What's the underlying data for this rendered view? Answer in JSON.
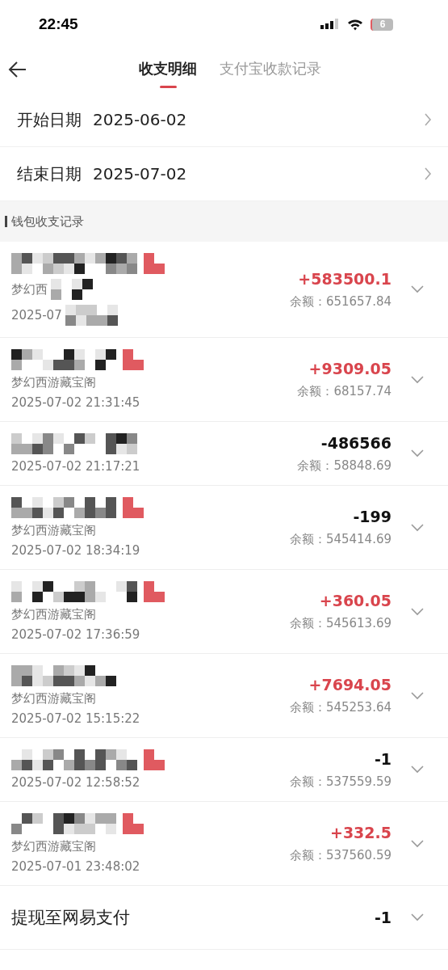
{
  "status_bar": {
    "time": "22:45",
    "battery": "6"
  },
  "tabs": [
    {
      "label": "收支明细",
      "selected": true
    },
    {
      "label": "支付宝收款记录",
      "selected": false
    }
  ],
  "date_filters": [
    {
      "label": "开始日期",
      "value": "2025-06-02"
    },
    {
      "label": "结束日期",
      "value": "2025-07-02"
    }
  ],
  "section_title": "钱包收支记录",
  "records": [
    {
      "title_redacted": true,
      "subtitle": "梦幻西",
      "subtitle_redacted": true,
      "time": "2025-07",
      "time_redacted": true,
      "amount": "+583500.1",
      "kind": "income",
      "balance": "余额：651657.84"
    },
    {
      "title_redacted": true,
      "subtitle": "梦幻西游藏宝阁",
      "subtitle_redacted": false,
      "time": "2025-07-02 21:31:45",
      "time_redacted": false,
      "amount": "+9309.05",
      "kind": "income",
      "balance": "余额：68157.74"
    },
    {
      "title_redacted": true,
      "time": "2025-07-02 21:17:21",
      "time_redacted": false,
      "amount": "-486566",
      "kind": "expense",
      "balance": "余额：58848.69"
    },
    {
      "title_redacted": true,
      "subtitle": "梦幻西游藏宝阁",
      "subtitle_redacted": false,
      "time": "2025-07-02 18:34:19",
      "time_redacted": false,
      "amount": "-199",
      "kind": "expense",
      "balance": "余额：545414.69"
    },
    {
      "title_redacted": true,
      "subtitle": "梦幻西游藏宝阁",
      "subtitle_redacted": false,
      "time": "2025-07-02 17:36:59",
      "time_redacted": false,
      "amount": "+360.05",
      "kind": "income",
      "balance": "余额：545613.69"
    },
    {
      "title_redacted": true,
      "subtitle": "梦幻西游藏宝阁",
      "subtitle_redacted": false,
      "time": "2025-07-02 15:15:22",
      "time_redacted": false,
      "amount": "+7694.05",
      "kind": "income",
      "balance": "余额：545253.64"
    },
    {
      "title_redacted": true,
      "time": "2025-07-02 12:58:52",
      "time_redacted": false,
      "amount": "-1",
      "kind": "expense",
      "balance": "余额：537559.59"
    },
    {
      "title_redacted": true,
      "subtitle": "梦幻西游藏宝阁",
      "subtitle_redacted": false,
      "time": "2025-07-01 23:48:02",
      "time_redacted": false,
      "amount": "+332.5",
      "kind": "income",
      "balance": "余额：537560.59"
    },
    {
      "title_redacted": false,
      "title": "提现至网易支付",
      "amount": "-1",
      "kind": "expense"
    }
  ]
}
